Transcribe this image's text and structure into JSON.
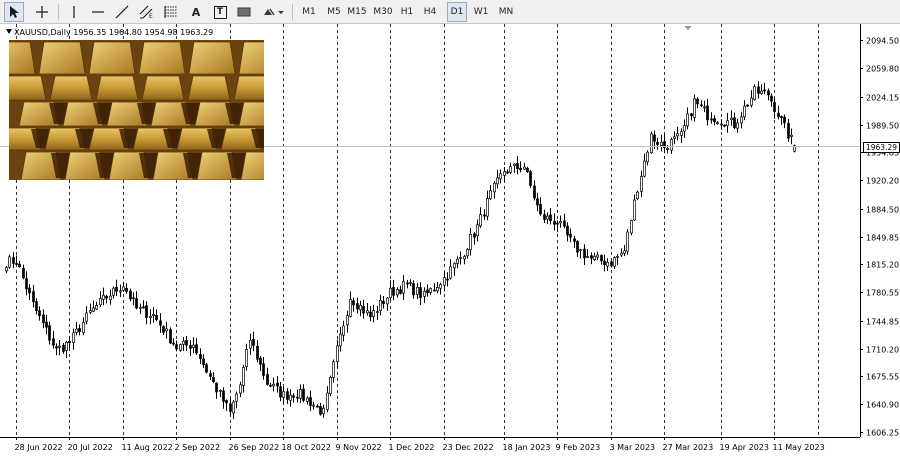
{
  "toolbar": {
    "timeframes": [
      "M1",
      "M5",
      "M15",
      "M30",
      "H1",
      "H4",
      "D1",
      "W1",
      "MN"
    ],
    "active_timeframe": "D1",
    "tools": [
      "cursor-icon",
      "crosshair-icon",
      "vertical-line-icon",
      "horizontal-line-icon",
      "trend-line-icon",
      "equidistant-channel-icon",
      "fibonacci-retracement-icon",
      "text-icon",
      "text-label-icon",
      "rectangle-icon",
      "shapes-dropdown-icon"
    ],
    "text_tool_label": "A",
    "text_label_tool_label": "T"
  },
  "chart": {
    "legend": "XAUUSD,Daily  1956.35 1964.80 1954.98 1963.29",
    "current_price": "1963.29",
    "colors": {
      "background": "#ffffff",
      "candle_up": "#ffffff",
      "candle_down": "#000000",
      "outline": "#000000",
      "grid": "#000000",
      "bid_line": "#c0c0c0"
    }
  },
  "chart_data": {
    "type": "candlestick",
    "symbol": "XAUUSD",
    "timeframe": "Daily",
    "ohlc_last": {
      "open": 1956.35,
      "high": 1964.8,
      "low": 1954.98,
      "close": 1963.29
    },
    "ylim": [
      1600,
      2115
    ],
    "y_ticks": [
      "2094.50",
      "2059.80",
      "2024.15",
      "1989.50",
      "1954.85",
      "1920.20",
      "1884.50",
      "1849.85",
      "1815.20",
      "1780.55",
      "1744.85",
      "1710.20",
      "1675.55",
      "1640.90",
      "1606.25"
    ],
    "x_ticks": [
      "28 Jun 2022",
      "20 Jul 2022",
      "11 Aug 2022",
      "2 Sep 2022",
      "26 Sep 2022",
      "18 Oct 2022",
      "9 Nov 2022",
      "1 Dec 2022",
      "23 Dec 2022",
      "18 Jan 2023",
      "9 Feb 2023",
      "3 Mar 2023",
      "27 Mar 2023",
      "19 Apr 2023",
      "11 May 2023"
    ],
    "close_path": [
      [
        "28 Jun 2022",
        1820
      ],
      [
        "5 Jul 2022",
        1765
      ],
      [
        "14 Jul 2022",
        1708
      ],
      [
        "20 Jul 2022",
        1718
      ],
      [
        "28 Jul 2022",
        1755
      ],
      [
        "4 Aug 2022",
        1775
      ],
      [
        "11 Aug 2022",
        1790
      ],
      [
        "17 Aug 2022",
        1760
      ],
      [
        "24 Aug 2022",
        1752
      ],
      [
        "2 Sep 2022",
        1712
      ],
      [
        "9 Sep 2022",
        1716
      ],
      [
        "16 Sep 2022",
        1675
      ],
      [
        "26 Sep 2022",
        1630
      ],
      [
        "29 Sep 2022",
        1665
      ],
      [
        "4 Oct 2022",
        1722
      ],
      [
        "11 Oct 2022",
        1668
      ],
      [
        "18 Oct 2022",
        1652
      ],
      [
        "24 Oct 2022",
        1655
      ],
      [
        "28 Oct 2022",
        1644
      ],
      [
        "3 Nov 2022",
        1630
      ],
      [
        "9 Nov 2022",
        1708
      ],
      [
        "15 Nov 2022",
        1775
      ],
      [
        "23 Nov 2022",
        1750
      ],
      [
        "1 Dec 2022",
        1780
      ],
      [
        "8 Dec 2022",
        1790
      ],
      [
        "15 Dec 2022",
        1775
      ],
      [
        "23 Dec 2022",
        1798
      ],
      [
        "30 Dec 2022",
        1824
      ],
      [
        "6 Jan 2023",
        1862
      ],
      [
        "12 Jan 2023",
        1902
      ],
      [
        "18 Jan 2023",
        1932
      ],
      [
        "26 Jan 2023",
        1938
      ],
      [
        "2 Feb 2023",
        1875
      ],
      [
        "9 Feb 2023",
        1868
      ],
      [
        "16 Feb 2023",
        1838
      ],
      [
        "23 Feb 2023",
        1822
      ],
      [
        "3 Mar 2023",
        1818
      ],
      [
        "9 Mar 2023",
        1832
      ],
      [
        "15 Mar 2023",
        1912
      ],
      [
        "21 Mar 2023",
        1975
      ],
      [
        "27 Mar 2023",
        1962
      ],
      [
        "3 Apr 2023",
        1975
      ],
      [
        "7 Apr 2023",
        2018
      ],
      [
        "13 Apr 2023",
        2002
      ],
      [
        "19 Apr 2023",
        1996
      ],
      [
        "25 Apr 2023",
        1990
      ],
      [
        "3 May 2023",
        2030
      ],
      [
        "9 May 2023",
        2028
      ],
      [
        "11 May 2023",
        2012
      ],
      [
        "16 May 2023",
        1985
      ],
      [
        "19 May 2023",
        1963
      ]
    ]
  }
}
